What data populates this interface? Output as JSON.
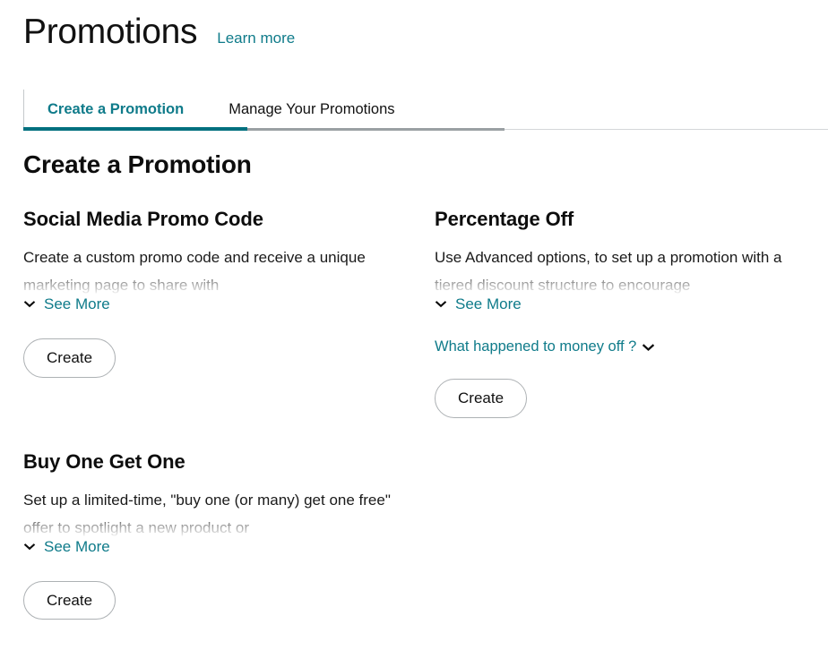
{
  "header": {
    "title": "Promotions",
    "learn_more_label": "Learn more"
  },
  "tabs": [
    {
      "label": "Create a Promotion",
      "active": true
    },
    {
      "label": "Manage Your Promotions",
      "active": false
    }
  ],
  "section": {
    "heading": "Create a Promotion"
  },
  "colors": {
    "accent_teal": "#0f7b8a",
    "active_tab_underline": "#01707f",
    "tab_rule_gray": "#9aa0a3",
    "button_border": "#adb1b4",
    "text": "#111111"
  },
  "cards": [
    {
      "id": "social-media-promo-code",
      "title": "Social Media Promo Code",
      "description": "Create a custom promo code and receive a unique marketing page to share with",
      "see_more_label": "See More",
      "create_label": "Create"
    },
    {
      "id": "percentage-off",
      "title": "Percentage Off",
      "description": "Use Advanced options, to set up a promotion with a tiered discount structure to encourage",
      "see_more_label": "See More",
      "money_off_label": "What happened to money off ?",
      "create_label": "Create"
    },
    {
      "id": "buy-one-get-one",
      "title": "Buy One Get One",
      "description": "Set up a limited-time, \"buy one (or many) get one free\" offer to spotlight a new product or",
      "see_more_label": "See More",
      "create_label": "Create"
    }
  ]
}
